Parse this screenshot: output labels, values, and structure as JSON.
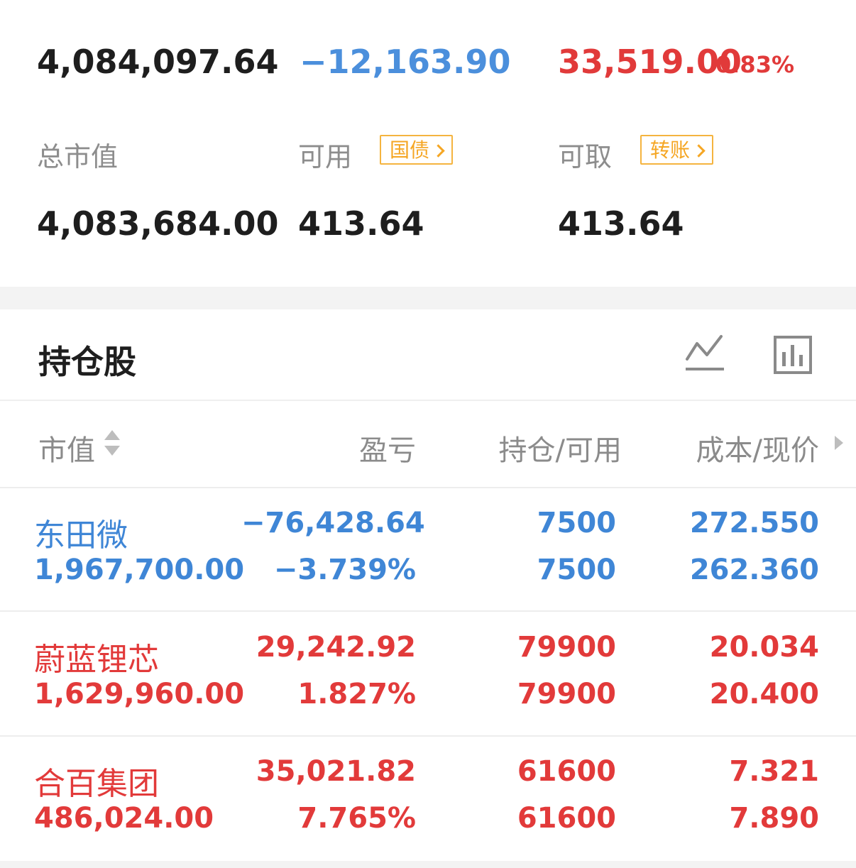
{
  "summary": {
    "total_assets": "4,084,097.64",
    "floating_pl": "−12,163.90",
    "today_pl": "33,519.00",
    "today_pl_pct": "0.83%",
    "labels": {
      "market_value": "总市值",
      "available": "可用",
      "withdrawable": "可取"
    },
    "market_value": "4,083,684.00",
    "available": "413.64",
    "withdrawable": "413.64",
    "badges": {
      "bond": "国债",
      "transfer": "转账"
    }
  },
  "holdings": {
    "title": "持仓股",
    "columns": {
      "market_value": "市值",
      "pl": "盈亏",
      "position": "持仓/可用",
      "cost": "成本/现价"
    },
    "rows": [
      {
        "name": "东田微",
        "market_value": "1,967,700.00",
        "pl": "−76,428.64",
        "pl_pct": "−3.739%",
        "position": "7500",
        "available": "7500",
        "cost": "272.550",
        "price": "262.360",
        "color": "#3f86d6"
      },
      {
        "name": "蔚蓝锂芯",
        "market_value": "1,629,960.00",
        "pl": "29,242.92",
        "pl_pct": "1.827%",
        "position": "79900",
        "available": "79900",
        "cost": "20.034",
        "price": "20.400",
        "color": "#e23a3a"
      },
      {
        "name": "合百集团",
        "market_value": "486,024.00",
        "pl": "35,021.82",
        "pl_pct": "7.765%",
        "position": "61600",
        "available": "61600",
        "cost": "7.321",
        "price": "7.890",
        "color": "#e23a3a"
      }
    ]
  },
  "icons": {
    "trend": "line-chart-icon",
    "bars": "bar-chart-icon"
  }
}
